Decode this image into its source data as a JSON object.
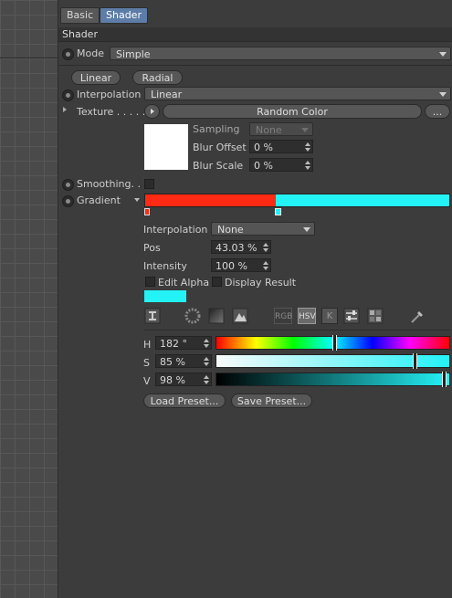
{
  "tabs": [
    {
      "label": "Basic"
    },
    {
      "label": "Shader"
    }
  ],
  "section_title": "Shader",
  "mode": {
    "label": "Mode",
    "value": "Simple"
  },
  "gradient_type_buttons": {
    "linear": "Linear",
    "radial": "Radial"
  },
  "interpolation_top": {
    "label": "Interpolation",
    "value": "Linear"
  },
  "texture": {
    "label": "Texture . . . . . .",
    "button": "Random Color",
    "more": "..."
  },
  "sampling": {
    "label": "Sampling",
    "value": "None"
  },
  "blur_offset": {
    "label": "Blur Offset",
    "value": "0 %"
  },
  "blur_scale": {
    "label": "Blur Scale",
    "value": "0 %"
  },
  "smoothing": {
    "label": "Smoothing. . ."
  },
  "gradient": {
    "label": "Gradient",
    "left_color": "#ff2a14",
    "right_color": "#23f2f7",
    "split_fraction": 0.4303
  },
  "knot": {
    "interpolation": {
      "label": "Interpolation",
      "value": "None"
    },
    "pos": {
      "label": "Pos",
      "value": "43.03 %"
    },
    "intensity": {
      "label": "Intensity",
      "value": "100 %"
    },
    "edit_alpha": "Edit Alpha",
    "display_result": "Display Result",
    "swatch_color": "#23f2f7"
  },
  "color_modes": {
    "rgb": "RGB",
    "hsv": "HSV",
    "k": "K"
  },
  "hsv": {
    "h": {
      "label": "H",
      "value": "182 °",
      "fraction": 0.505
    },
    "s": {
      "label": "S",
      "value": "85 %",
      "fraction": 0.85
    },
    "v": {
      "label": "V",
      "value": "98 %",
      "fraction": 0.98
    }
  },
  "presets": {
    "load": "Load Preset...",
    "save": "Save Preset..."
  }
}
